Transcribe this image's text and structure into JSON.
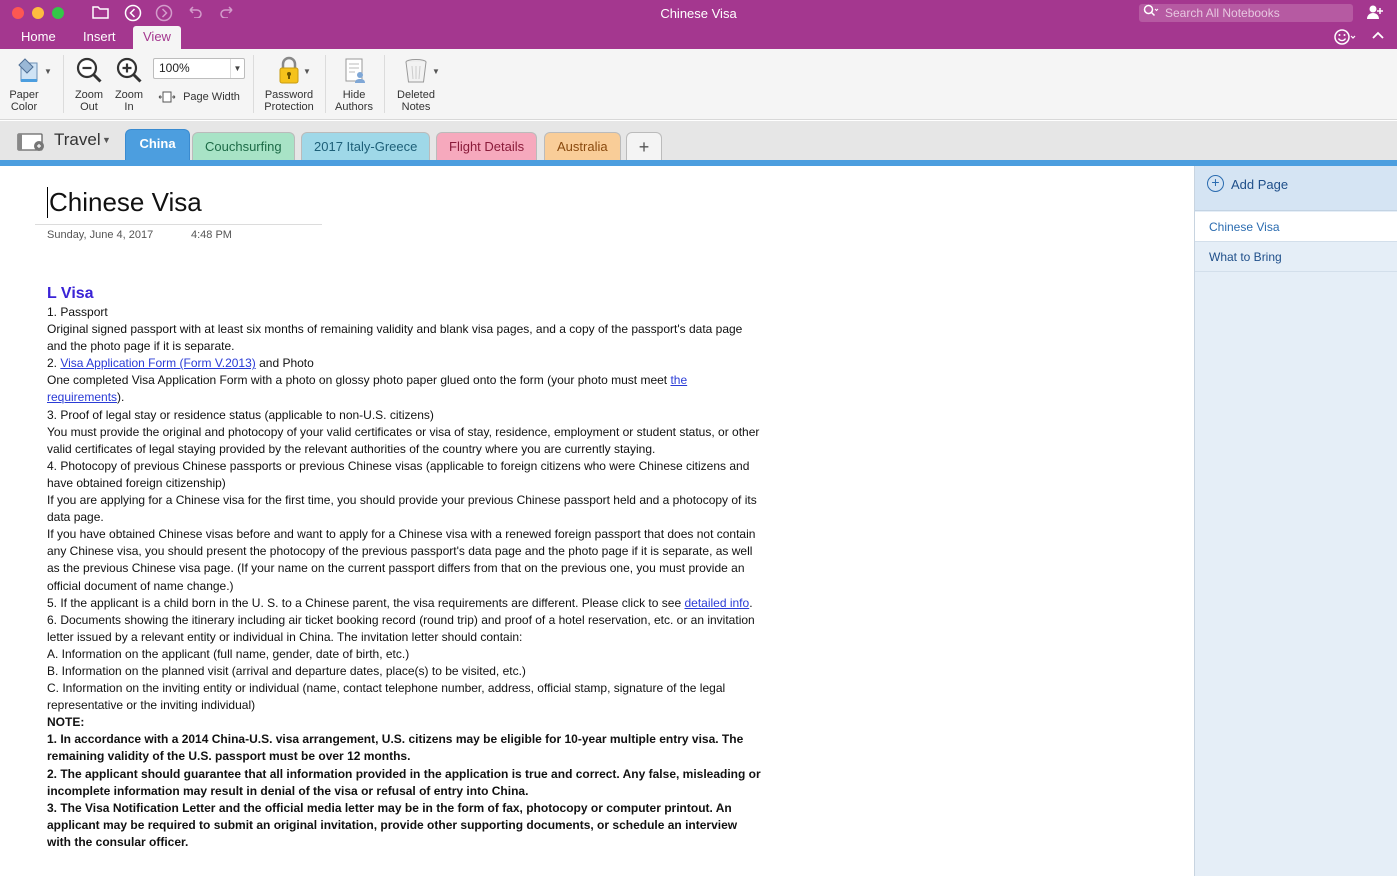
{
  "window": {
    "title": "Chinese Visa",
    "search_placeholder": "Search All Notebooks"
  },
  "ribbon": {
    "tabs": [
      "Home",
      "Insert",
      "View"
    ],
    "active_tab": "View"
  },
  "toolbar": {
    "paper_color": "Paper Color",
    "zoom_out": "Zoom Out",
    "zoom_in": "Zoom In",
    "zoom_value": "100%",
    "page_width": "Page Width",
    "password_protection": "Password Protection",
    "hide_authors": "Hide Authors",
    "deleted_notes": "Deleted Notes"
  },
  "notebook": {
    "name": "Travel",
    "sections": [
      {
        "label": "China",
        "color": "#4c9edf"
      },
      {
        "label": "Couchsurfing",
        "color": "#a8e3c6"
      },
      {
        "label": "2017 Italy-Greece",
        "color": "#9fd8e8"
      },
      {
        "label": "Flight Details",
        "color": "#f6a9bd"
      },
      {
        "label": "Australia",
        "color": "#f9cd98"
      }
    ],
    "add_section": "+"
  },
  "page": {
    "title": "Chinese Visa",
    "date": "Sunday, June 4, 2017",
    "time": "4:48 PM",
    "heading": "L Visa",
    "items": {
      "i1": "1. Passport",
      "i1_desc": "Original signed passport with at least six months of remaining validity and blank visa pages, and a copy of the passport's data page and the photo page if it is separate.",
      "i2_prefix": "2. ",
      "i2_link": "Visa Application Form (Form V.2013)",
      "i2_suffix": " and Photo",
      "i2_desc": "One completed Visa Application Form with a photo on glossy photo paper glued onto the form (your photo must meet ",
      "i2_desc_link": "the requirements",
      "i2_desc_end": ").",
      "i3": "3. Proof of legal stay or residence status (applicable to non-U.S. citizens)",
      "i3_desc": "You must provide the original and photocopy of your valid certificates or visa of stay, residence, employment or student status, or other valid certificates of legal staying provided by the relevant authorities of the country where you are currently staying.",
      "i4": "4. Photocopy of previous Chinese passports or previous Chinese visas (applicable to foreign citizens who were Chinese citizens and have obtained foreign citizenship)",
      "i4_desc1": "If you are applying for a Chinese visa for the first time, you should provide your previous Chinese passport held and a photocopy of its data page.",
      "i4_desc2": "If you have obtained Chinese visas before and want to apply for a Chinese visa with a renewed foreign passport that does not contain any Chinese visa, you should present the photocopy of the previous passport's data page and the photo page if it is separate, as well as the previous Chinese visa page. (If your name on the current passport differs from that on the previous one, you must provide an official document of name change.)",
      "i5": "5. If the applicant is a child born in the U. S. to a Chinese parent, the visa requirements are different.  Please click to see ",
      "i5_link": "detailed info",
      "i5_end": ".",
      "i6": "6. Documents showing the itinerary including air ticket booking record (round trip) and proof of a hotel reservation, etc. or an invitation letter issued by a relevant entity or individual in China. The invitation letter should contain:",
      "iA": "A.  Information on the applicant (full name, gender, date of birth, etc.)",
      "iB": "B.  Information on the planned visit (arrival and departure dates, place(s) to be visited, etc.)",
      "iC": "C.  Information on the inviting entity or individual (name, contact telephone number, address, official stamp, signature of the legal representative or the inviting individual)",
      "note": "NOTE:",
      "n1": "1. In accordance with a 2014 China-U.S. visa arrangement, U.S. citizens may be eligible for 10-year multiple entry visa. The remaining validity of the U.S. passport must be over 12 months.",
      "n2": "2. The applicant should guarantee that all information provided in the application is true and correct. Any false, misleading or incomplete information may result in denial of the visa or refusal of entry into China.",
      "n3": "3. The Visa Notification Letter and the official media letter may be in the form of fax, photocopy or computer printout. An applicant may be required to submit an original invitation, provide other supporting documents, or schedule an interview with the consular officer."
    }
  },
  "pages_panel": {
    "add_page": "Add Page",
    "pages": [
      "Chinese Visa",
      "What to Bring"
    ],
    "active": "Chinese Visa"
  }
}
